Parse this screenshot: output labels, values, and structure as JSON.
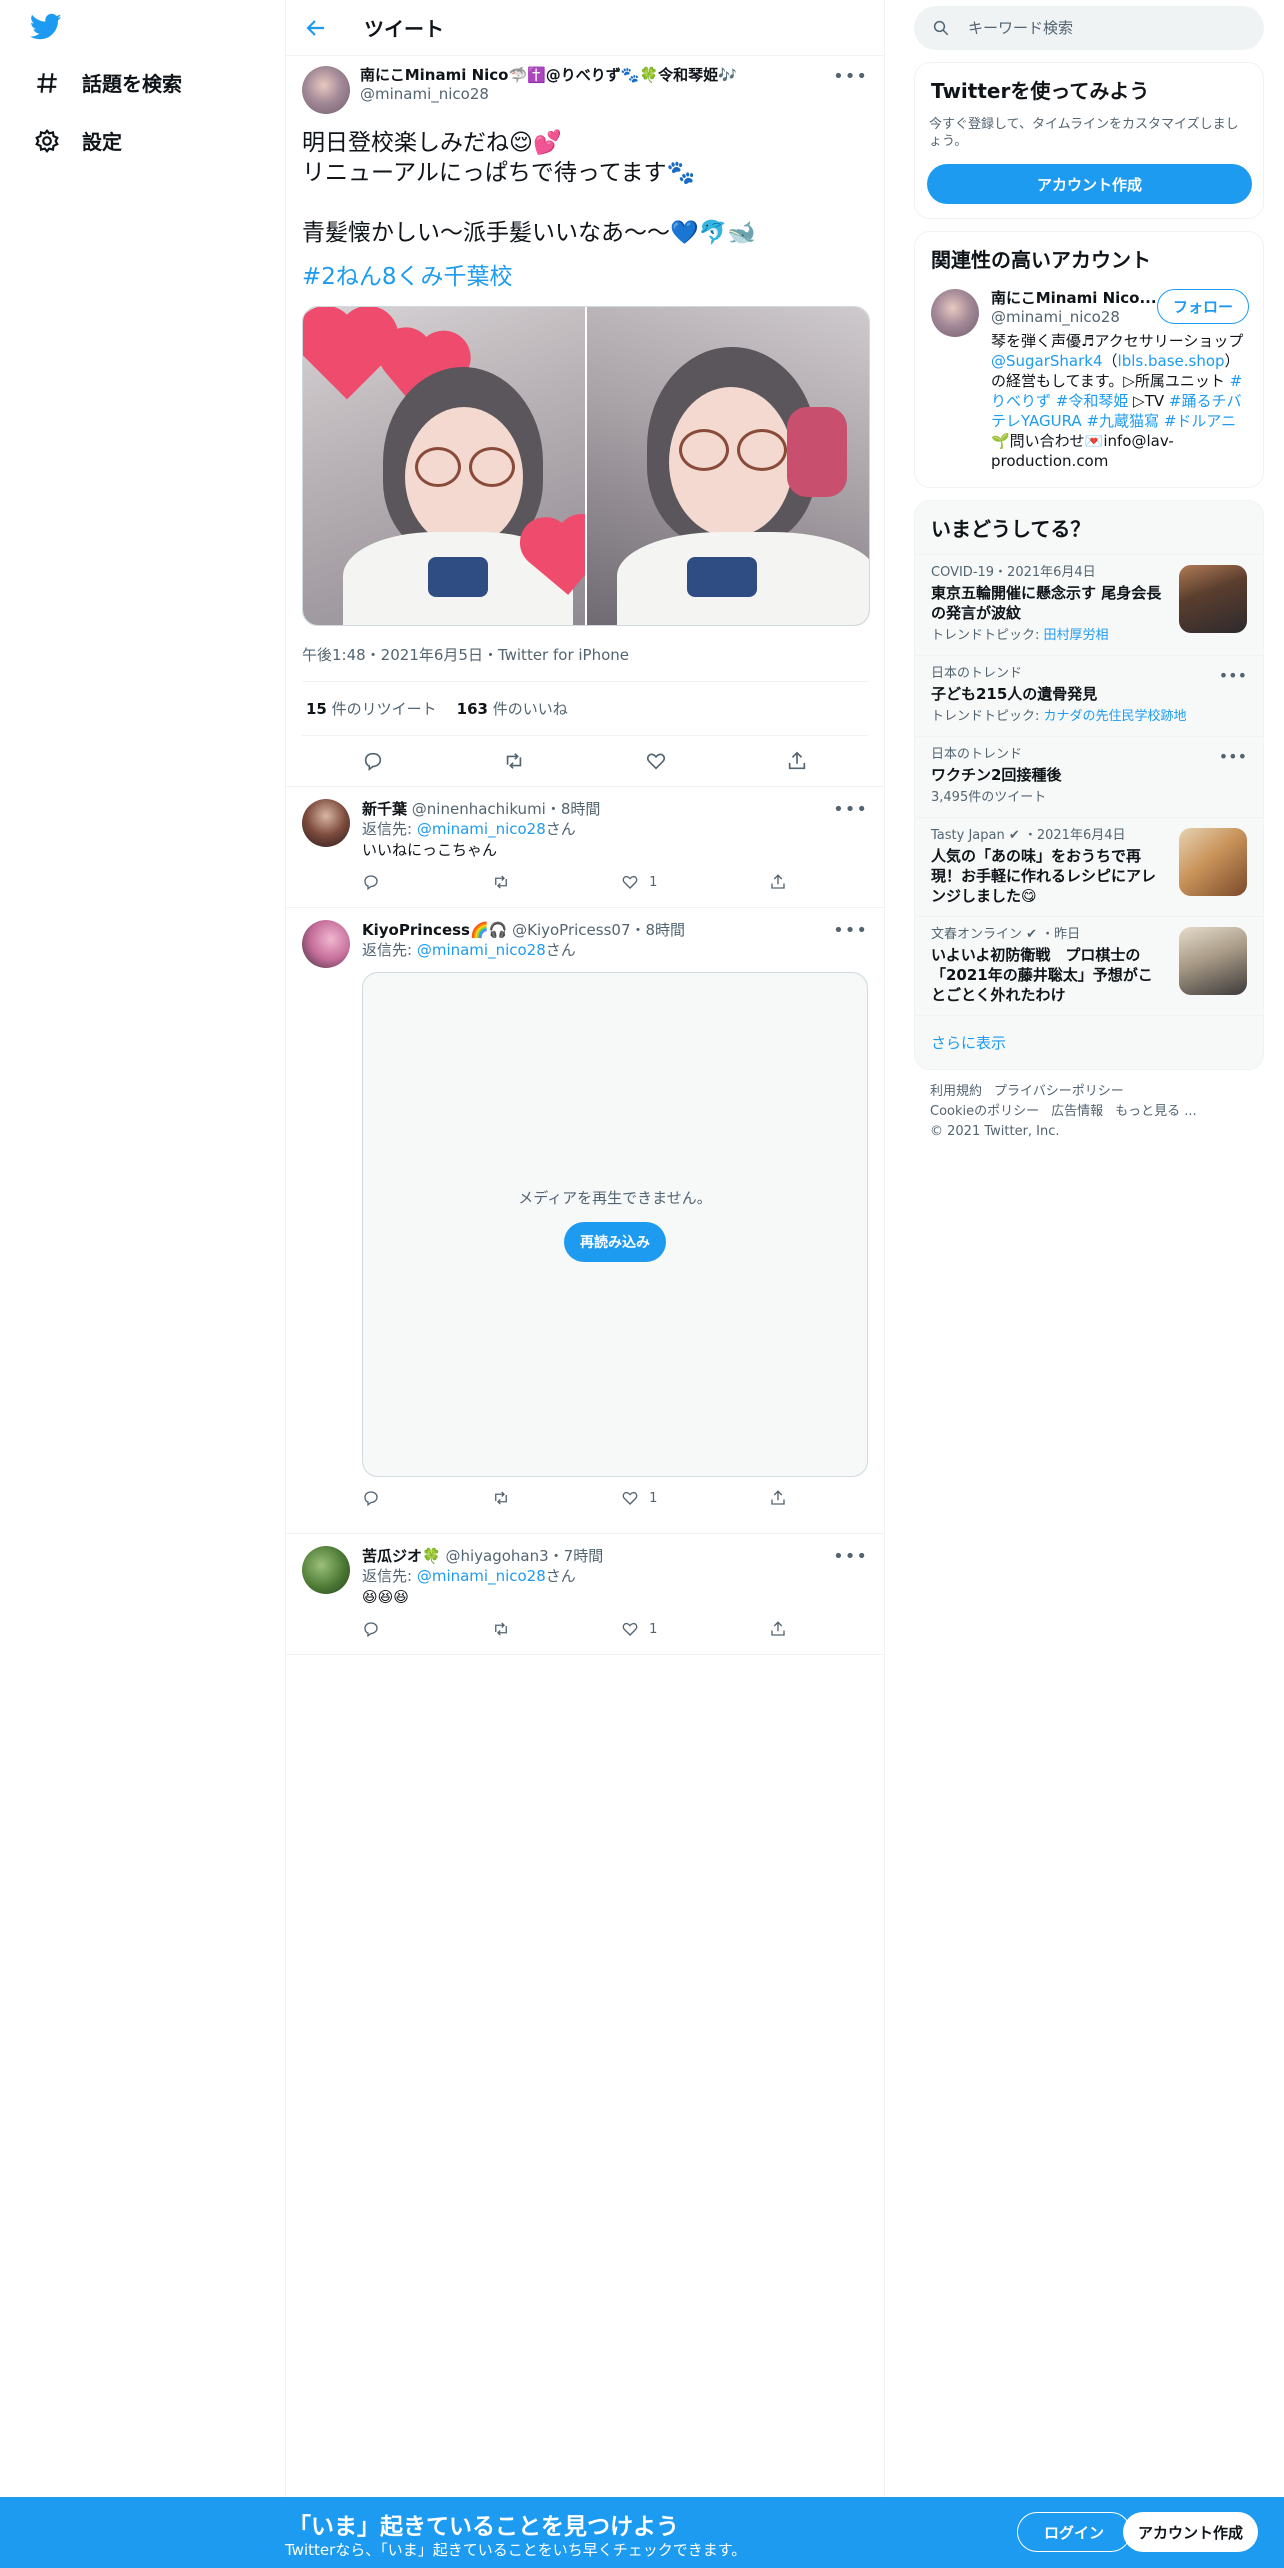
{
  "nav": {
    "explore_label": "話題を検索",
    "settings_label": "設定"
  },
  "header": {
    "title": "ツイート"
  },
  "tweet": {
    "author_name": "南にこMinami Nico🦈✝️@りべりず🐾🍀令和琴姫🎶",
    "author_handle": "@minami_nico28",
    "text_line1": "明日登校楽しみだね😌💕",
    "text_line2": "リニューアルにっぱちで待ってます🐾",
    "text_line3": "青髪懐かしい〜派手髪いいなあ〜〜💙🐬🐋",
    "hashtag": "#2ねん8くみ千葉校",
    "meta": "午後1:48・2021年6月5日・Twitter for iPhone",
    "retweet_count": "15",
    "retweet_label": "件のリツイート",
    "like_count": "163",
    "like_label": "件のいいね"
  },
  "replies": [
    {
      "name": "新千葉",
      "handle": "@ninenhachikumi",
      "time": "・8時間",
      "reply_prefix": "返信先: ",
      "reply_to": "@minami_nico28",
      "reply_suffix": "さん",
      "text": "いいねにっこちゃん",
      "like_count": "1"
    },
    {
      "name": "KiyoPrincess🌈🎧",
      "handle": "@KiyoPricess07",
      "time": "・8時間",
      "reply_prefix": "返信先: ",
      "reply_to": "@minami_nico28",
      "reply_suffix": "さん",
      "media_error": "メディアを再生できません。",
      "reload_label": "再読み込み",
      "like_count": "1"
    },
    {
      "name": "苦瓜ジオ🍀",
      "handle": "@hiyagohan3",
      "time": "・7時間",
      "reply_prefix": "返信先: ",
      "reply_to": "@minami_nico28",
      "reply_suffix": "さん",
      "text": "😆😆😆",
      "like_count": "1"
    }
  ],
  "search": {
    "placeholder": "キーワード検索"
  },
  "signup_card": {
    "title": "Twitterを使ってみよう",
    "desc": "今すぐ登録して、タイムラインをカスタマイズしましょう。",
    "button": "アカウント作成"
  },
  "related": {
    "title": "関連性の高いアカウント",
    "name": "南にこMinami Nico...",
    "handle": "@minami_nico28",
    "follow_label": "フォロー",
    "bio_1": "琴を弾く声優♬アクセサリーショップ",
    "bio_link1": "@SugarShark4",
    "bio_paren_open": "（",
    "bio_link2": "lbls.base.shop",
    "bio_paren_close": "）の経営もしてます。▷所属ユニット",
    "bio_tag1": "#りべりず",
    "bio_tag2": "#令和琴姫",
    "bio_tv": "▷TV",
    "bio_tag3": "#踊るチバテレYAGURA",
    "bio_tag4": "#九蔵猫寫",
    "bio_tag5": "#ドルアニ",
    "bio_end": "🌱問い合わせ💌info@lav-production.com"
  },
  "trends": {
    "title": "いまどうしてる？",
    "items": [
      {
        "category": "COVID-19・2021年6月4日",
        "title": "東京五輪開催に懸念示す 尾身会長の発言が波紋",
        "sub_label": "トレンドトピック: ",
        "sub_link": "田村厚労相"
      },
      {
        "category": "日本のトレンド",
        "title": "子ども215人の遺骨発見",
        "sub_label": "トレンドトピック: ",
        "sub_link": "カナダの先住民学校跡地"
      },
      {
        "category": "日本のトレンド",
        "title": "ワクチン2回接種後",
        "sub_label": "3,495件のツイート",
        "sub_link": ""
      },
      {
        "category": "Tasty Japan ✔ ・2021年6月4日",
        "title": "人気の「あの味」をおうちで再現！お手軽に作れるレシピにアレンジしました😋",
        "sub_label": "",
        "sub_link": ""
      },
      {
        "category": "文春オンライン ✔ ・昨日",
        "title": "いよいよ初防衛戦　プロ棋士の「2021年の藤井聡太」予想がことごとく外れたわけ",
        "sub_label": "",
        "sub_link": ""
      }
    ],
    "show_more": "さらに表示"
  },
  "footer": {
    "terms": "利用規約",
    "privacy": "プライバシーポリシー",
    "cookie": "Cookieのポリシー",
    "ads": "広告情報",
    "more": "もっと見る ...",
    "copyright": "© 2021 Twitter, Inc."
  },
  "bottom_bar": {
    "headline": "「いま」起きていることを見つけよう",
    "sub": "Twitterなら、「いま」起きていることをいち早くチェックできます。",
    "login": "ログイン",
    "signup": "アカウント作成"
  },
  "colors": {
    "accent": "#1d9bf0",
    "text": "#0f1419",
    "muted": "#536471"
  }
}
